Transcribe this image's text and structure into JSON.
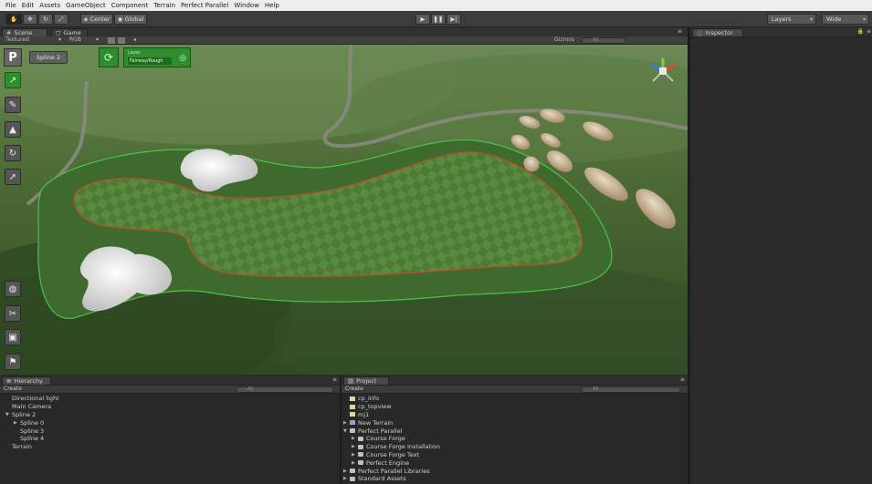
{
  "menu": [
    "File",
    "Edit",
    "Assets",
    "GameObject",
    "Component",
    "Terrain",
    "Perfect Parallel",
    "Window",
    "Help"
  ],
  "toolbar": {
    "pivot_label": "Center",
    "space_label": "Global",
    "layers_label": "Layers",
    "layout_label": "Wide"
  },
  "scene": {
    "tab_scene": "Scene",
    "tab_game": "Game",
    "render_mode": "Textured",
    "color_mode": "RGB",
    "gizmos_label": "Gizmos",
    "search_placeholder": "All",
    "spline_label": "Spline 2",
    "logo_text": "P",
    "layer_caption": "Layer",
    "layer_value": "Fairway/Rough"
  },
  "inspector": {
    "tab": "Inspector"
  },
  "hierarchy": {
    "tab": "Hierarchy",
    "create_label": "Create",
    "search_placeholder": "All",
    "items": [
      {
        "label": "Directional light",
        "indent": 0,
        "arrow": ""
      },
      {
        "label": "Main Camera",
        "indent": 0,
        "arrow": ""
      },
      {
        "label": "Spline 2",
        "indent": 0,
        "arrow": "▼"
      },
      {
        "label": "Spline 0",
        "indent": 1,
        "arrow": "▶"
      },
      {
        "label": "Spline 3",
        "indent": 1,
        "arrow": ""
      },
      {
        "label": "Spline 4",
        "indent": 1,
        "arrow": ""
      },
      {
        "label": "Terrain",
        "indent": 0,
        "arrow": ""
      }
    ]
  },
  "project": {
    "tab": "Project",
    "create_label": "Create",
    "search_placeholder": "All",
    "items": [
      {
        "label": "cp_info",
        "indent": 0,
        "arrow": "",
        "icon": "file"
      },
      {
        "label": "cp_topview",
        "indent": 0,
        "arrow": "",
        "icon": "file"
      },
      {
        "label": "mj1",
        "indent": 0,
        "arrow": "",
        "icon": "file"
      },
      {
        "label": "New Terrain",
        "indent": 0,
        "arrow": "▶",
        "icon": "terrain"
      },
      {
        "label": "Perfect Parallel",
        "indent": 0,
        "arrow": "▼",
        "icon": "folder"
      },
      {
        "label": "Course Forge",
        "indent": 1,
        "arrow": "▶",
        "icon": "folder"
      },
      {
        "label": "Course Forge Installation",
        "indent": 1,
        "arrow": "▶",
        "icon": "folder"
      },
      {
        "label": "Course Forge Text",
        "indent": 1,
        "arrow": "▶",
        "icon": "folder"
      },
      {
        "label": "Perfect Engine",
        "indent": 1,
        "arrow": "▶",
        "icon": "folder"
      },
      {
        "label": "Perfect Parallel Libraries",
        "indent": 0,
        "arrow": "▶",
        "icon": "folder"
      },
      {
        "label": "Standard Assets",
        "indent": 0,
        "arrow": "▶",
        "icon": "folder"
      }
    ]
  }
}
